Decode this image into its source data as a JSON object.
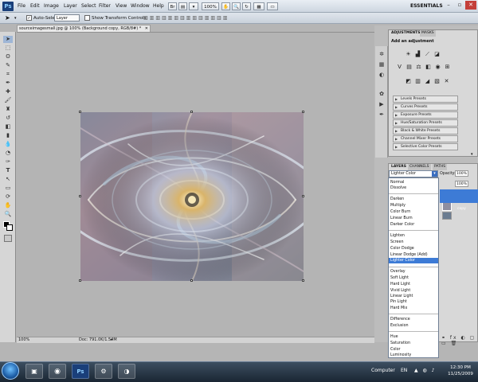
{
  "menubar": {
    "logo": "Ps",
    "items": [
      "File",
      "Edit",
      "Image",
      "Layer",
      "Select",
      "Filter",
      "View",
      "Window",
      "Help"
    ],
    "zoom": "100%",
    "workspace": "ESSENTIALS",
    "window_controls": [
      "–",
      "▫",
      "✕"
    ]
  },
  "options": {
    "auto_select_label": "Auto-Select:",
    "auto_select_value": "Layer",
    "show_transform_label": "Show Transform Controls"
  },
  "document": {
    "tab_title": "sourceimagesmall.jpg @ 100% (Background copy, RGB/8#) *",
    "zoom": "100%",
    "doc_info": "Doc: 791.0K/1.54M"
  },
  "adjustments": {
    "tabs": [
      "ADJUSTMENTS",
      "MASKS"
    ],
    "heading": "Add an adjustment",
    "presets": [
      "Levels Presets",
      "Curves Presets",
      "Exposure Presets",
      "Hue/Saturation Presets",
      "Black & White Presets",
      "Channel Mixer Presets",
      "Selective Color Presets"
    ]
  },
  "layers": {
    "tabs": [
      "LAYERS",
      "CHANNELS",
      "PATHS"
    ],
    "blend_mode": "Lighter Color",
    "opacity_label": "Opacity:",
    "opacity": "100%",
    "fill": "100%",
    "blend_groups": [
      [
        "Normal",
        "Dissolve"
      ],
      [
        "Darken",
        "Multiply",
        "Color Burn",
        "Linear Burn",
        "Darker Color"
      ],
      [
        "Lighten",
        "Screen",
        "Color Dodge",
        "Linear Dodge (Add)",
        "Lighter Color"
      ],
      [
        "Overlay",
        "Soft Light",
        "Hard Light",
        "Vivid Light",
        "Linear Light",
        "Pin Light",
        "Hard Mix"
      ],
      [
        "Difference",
        "Exclusion"
      ],
      [
        "Hue",
        "Saturation",
        "Color",
        "Luminosity"
      ]
    ]
  },
  "taskbar": {
    "computer_label": "Computer",
    "lang": "EN",
    "time": "12:30 PM",
    "date": "11/25/2009"
  },
  "colors": {
    "selection": "#3d7bd6",
    "accent": "#1a3f7a"
  }
}
